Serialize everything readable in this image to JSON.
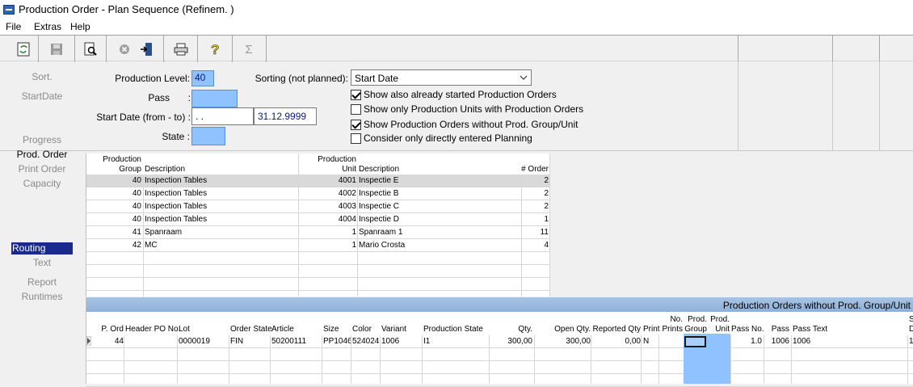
{
  "window": {
    "title": "Production Order - Plan Sequence (Refinem. )"
  },
  "menu": [
    "File",
    "Extras",
    "Help"
  ],
  "toolbar": {
    "icons": [
      "refresh-icon",
      "save-icon",
      "preview-icon",
      "cancel-icon",
      "exit-icon",
      "print-icon",
      "help-icon",
      "sum-icon"
    ]
  },
  "nav": {
    "sort": "Sort.",
    "start_date": "StartDate",
    "progress": "Progress",
    "prod_order": "Prod. Order",
    "print_order": "Print Order",
    "capacity": "Capacity",
    "routing": "Routing",
    "text": "Text",
    "report": "Report",
    "runtimes": "Runtimes"
  },
  "form": {
    "production_level_label": "Production Level:",
    "production_level_value": "40",
    "pass_label": "Pass",
    "pass_colon": ":",
    "start_date_label": "Start Date (from - to) :",
    "start_date_from": " .  . ",
    "start_date_to": "31.12.9999",
    "state_label": "State :",
    "sorting_label": "Sorting (not planned):",
    "sorting_value": "Start Date",
    "checks": [
      {
        "label": "Show also already started Production Orders",
        "checked": true
      },
      {
        "label": "Show only Production Units with Production Orders",
        "checked": false
      },
      {
        "label": "Show Production Orders without Prod. Group/Unit",
        "checked": true
      },
      {
        "label": "Consider only directly entered Planning",
        "checked": false
      }
    ]
  },
  "grid1": {
    "headers": {
      "prod_group_l1": "Production",
      "prod_group_l2": "Group",
      "description": "Description",
      "prod_unit_l1": "Production",
      "prod_unit_l2": "Unit",
      "unit_description": "Description",
      "order_count": "# Order"
    },
    "rows": [
      {
        "group": "40",
        "desc": "Inspection Tables",
        "unit": "4001",
        "unit_desc": "Inspectie E",
        "orders": "2"
      },
      {
        "group": "40",
        "desc": "Inspection Tables",
        "unit": "4002",
        "unit_desc": "Inspectie B",
        "orders": "2"
      },
      {
        "group": "40",
        "desc": "Inspection Tables",
        "unit": "4003",
        "unit_desc": "Inspectie C",
        "orders": "2"
      },
      {
        "group": "40",
        "desc": "Inspection Tables",
        "unit": "4004",
        "unit_desc": "Inspectie D",
        "orders": "1"
      },
      {
        "group": "41",
        "desc": "Spanraam",
        "unit": "1",
        "unit_desc": "Spanraam 1",
        "orders": "11"
      },
      {
        "group": "42",
        "desc": "MC",
        "unit": "1",
        "unit_desc": "Mario Crosta",
        "orders": "4"
      }
    ]
  },
  "grid2": {
    "title": "Production Orders without Prod. Group/Unit",
    "headers": {
      "p_ord": "P. Ord",
      "header_po": "Header PO No.",
      "lot": "Lot",
      "order_state": "Order State",
      "article": "Article",
      "size": "Size",
      "color": "Color",
      "variant": "Variant",
      "prod_state": "Production State",
      "qty": "Qty.",
      "open_qty": "Open Qty.",
      "reported_qty": "Reported Qty",
      "print": "Print",
      "no_prints_l1": "No.",
      "no_prints_l2": "Prints",
      "prod_group_l1": "Prod.",
      "prod_group_l2": "Group",
      "prod_unit_l1": "Prod.",
      "prod_unit_l2": "Unit",
      "pass_no": "Pass No.",
      "pass": "Pass",
      "pass_text": "Pass Text",
      "extra_l1": "S",
      "extra_l2": "D"
    },
    "rows": [
      {
        "p_ord": "44",
        "header_po": "",
        "lot": "0000019",
        "order_state": "FIN",
        "article": "50200111",
        "size": "PP1046",
        "color": "524024",
        "variant": "1006",
        "prod_state": "I1",
        "qty": "300,00",
        "open_qty": "300,00",
        "reported_qty": "0,00",
        "print": "N",
        "no_prints": "",
        "pass_no": "1.0",
        "pass": "1006",
        "pass_text": "1006",
        "extra": "1"
      }
    ]
  },
  "colors": {
    "field": "#8fc2ff",
    "selected_nav": "#1a2a8c",
    "panel_header": "#a8c4e4"
  }
}
